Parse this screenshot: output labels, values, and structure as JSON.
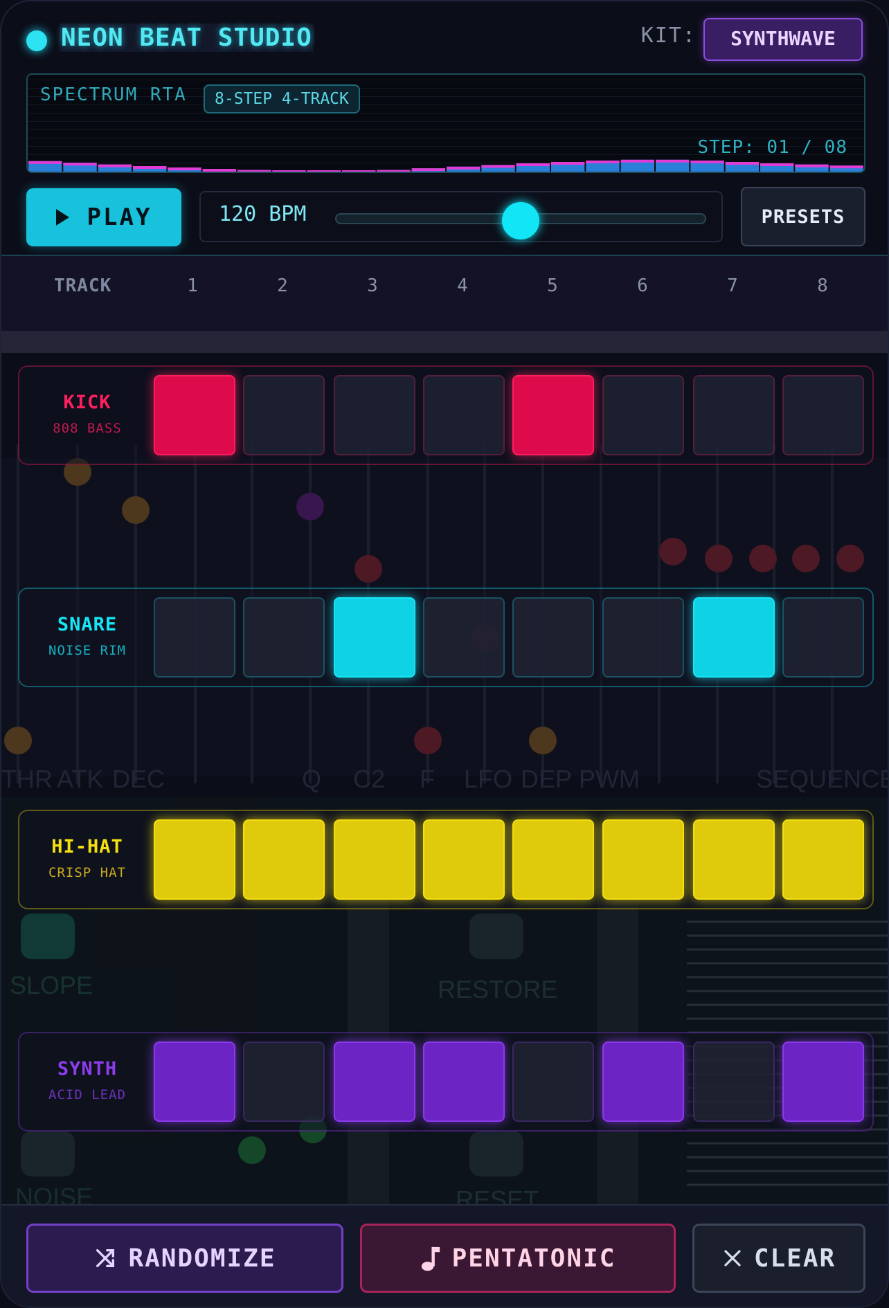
{
  "header": {
    "title": "NEON BEAT STUDIO",
    "kit_label": "KIT:",
    "kit_value": "SYNTHWAVE"
  },
  "spectrum": {
    "title": "SPECTRUM RTA",
    "badge": "8-STEP 4-TRACK",
    "step_readout": "STEP: 01 / 08",
    "levels": [
      0.38,
      0.32,
      0.26,
      0.2,
      0.15,
      0.1,
      0.06,
      0.05,
      0.04,
      0.04,
      0.06,
      0.12,
      0.18,
      0.24,
      0.3,
      0.35,
      0.4,
      0.43,
      0.43,
      0.4,
      0.35,
      0.3,
      0.26,
      0.22
    ]
  },
  "transport": {
    "play_label": "PLAY",
    "bpm_text": "120 BPM",
    "tempo_level": 0.5,
    "presets_label": "PRESETS"
  },
  "grid_header": {
    "track_label": "TRACK",
    "steps": [
      "1",
      "2",
      "3",
      "4",
      "5",
      "6",
      "7",
      "8"
    ]
  },
  "tracks": [
    {
      "name": "KICK",
      "sub": "808 BASS",
      "color": "#ff1f5e",
      "pattern": [
        1,
        0,
        0,
        0,
        1,
        0,
        0,
        0
      ]
    },
    {
      "name": "SNARE",
      "sub": "NOISE RIM",
      "color": "#17e6f6",
      "pattern": [
        0,
        0,
        1,
        0,
        0,
        0,
        1,
        0
      ]
    },
    {
      "name": "HI-HAT",
      "sub": "CRISP HAT",
      "color": "#f5e010",
      "pattern": [
        1,
        1,
        1,
        1,
        1,
        1,
        1,
        1
      ]
    },
    {
      "name": "SYNTH",
      "sub": "ACID LEAD",
      "color": "#8e3cf0",
      "pattern": [
        1,
        0,
        1,
        1,
        0,
        1,
        0,
        1
      ]
    }
  ],
  "actions": {
    "randomize": "RANDOMIZE",
    "pentatonic": "PENTATONIC",
    "clear": "CLEAR"
  },
  "background_labels": [
    "THR",
    "ATK",
    "DEC",
    "Q",
    "C2",
    "F",
    "LFO",
    "DEP",
    "PWM",
    "SEQUENCER",
    "SLOPE",
    "RESTORE",
    "NOISE",
    "RESET"
  ],
  "colors": {
    "accent": "#17e6f6",
    "kick": "#ff1f5e",
    "snare": "#17e6f6",
    "hihat": "#f5e010",
    "synth": "#8e3cf0"
  }
}
